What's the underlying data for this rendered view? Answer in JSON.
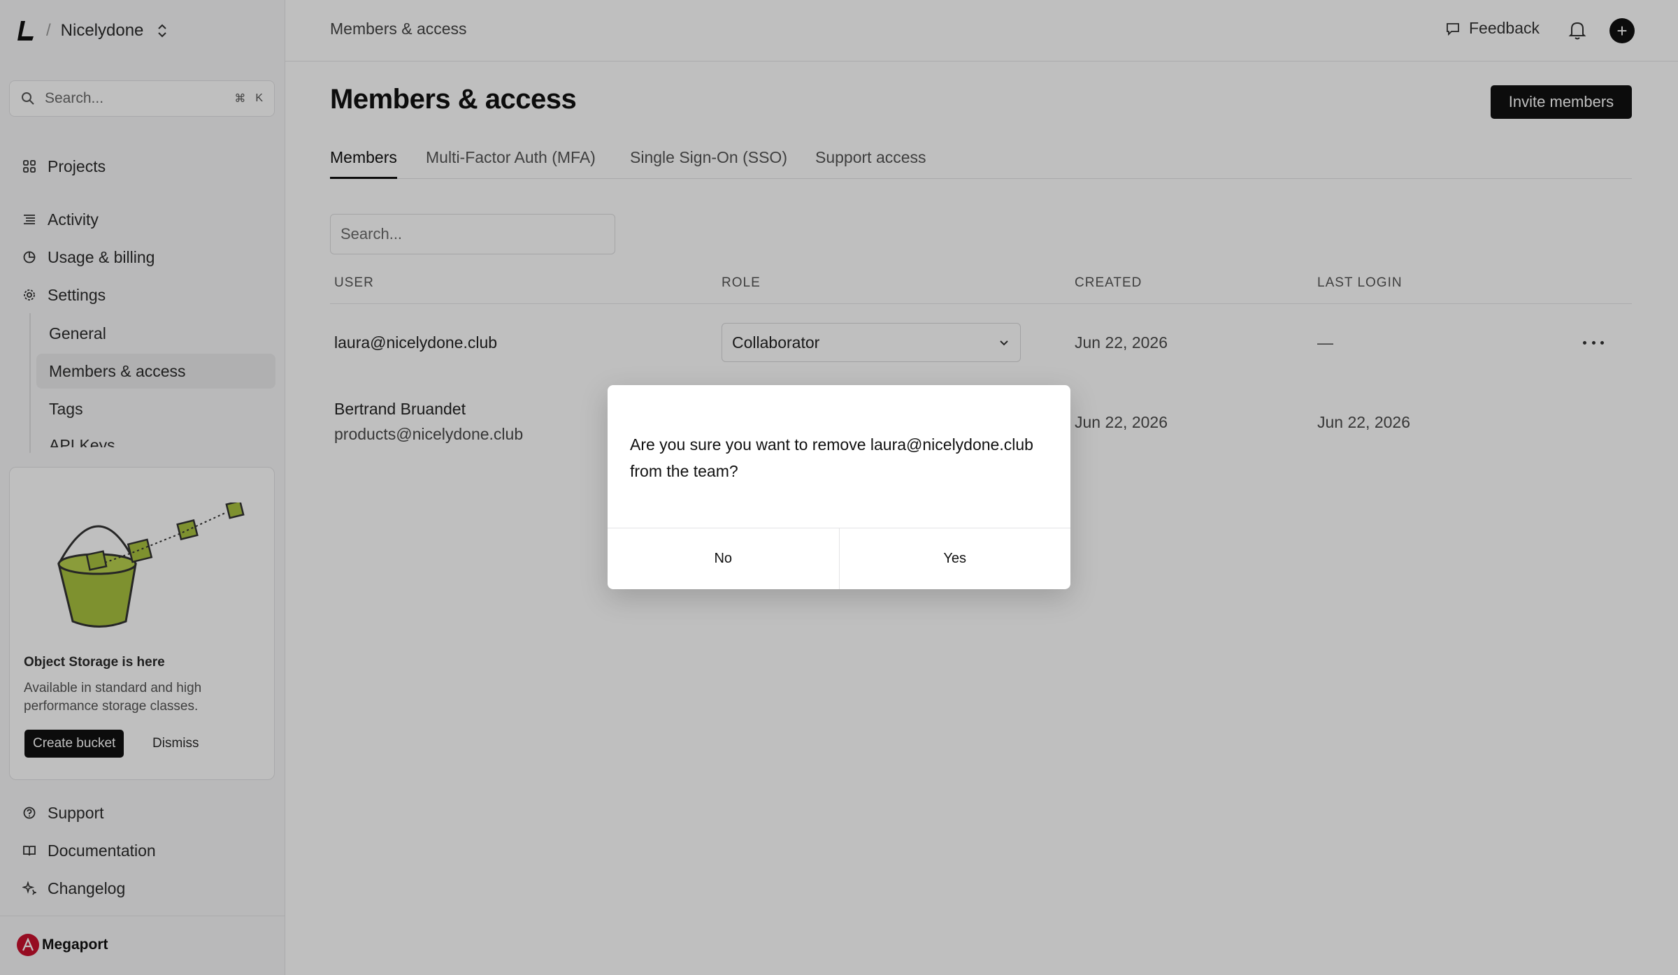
{
  "sidebar": {
    "org_name": "Nicelydone",
    "search_placeholder": "Search...",
    "search_shortcut": [
      "⌘",
      "K"
    ],
    "nav": {
      "projects": "Projects",
      "activity": "Activity",
      "usage_billing": "Usage & billing",
      "settings": "Settings"
    },
    "settings_sub": [
      "General",
      "Members & access",
      "Tags",
      "API Keys"
    ],
    "promo": {
      "title": "Object Storage is here",
      "description": "Available in standard and high performance storage classes.",
      "create_label": "Create bucket",
      "dismiss_label": "Dismiss"
    },
    "bottom_nav": {
      "support": "Support",
      "documentation": "Documentation",
      "changelog": "Changelog"
    },
    "footer_brand": "Megaport"
  },
  "topbar": {
    "breadcrumb": "Members & access",
    "feedback": "Feedback"
  },
  "main": {
    "title": "Members & access",
    "invite_label": "Invite members",
    "tabs": [
      "Members",
      "Multi-Factor Auth (MFA)",
      "Single Sign-On (SSO)",
      "Support access"
    ],
    "search_placeholder": "Search...",
    "columns": [
      "USER",
      "ROLE",
      "CREATED",
      "LAST LOGIN"
    ],
    "rows": [
      {
        "user": "laura@nicelydone.club",
        "role": "Collaborator",
        "created": "Jun 22, 2026",
        "last_login": "—"
      },
      {
        "name": "Bertrand Bruandet",
        "email": "products@nicelydone.club",
        "created": "Jun 22, 2026",
        "last_login": "Jun 22, 2026"
      }
    ]
  },
  "modal": {
    "message": "Are you sure you want to remove laura@nicelydone.club from the team?",
    "no_label": "No",
    "yes_label": "Yes"
  },
  "colors": {
    "accent": "#111111",
    "promo_green": "#a9c23f",
    "brand_red": "#c8102e"
  }
}
